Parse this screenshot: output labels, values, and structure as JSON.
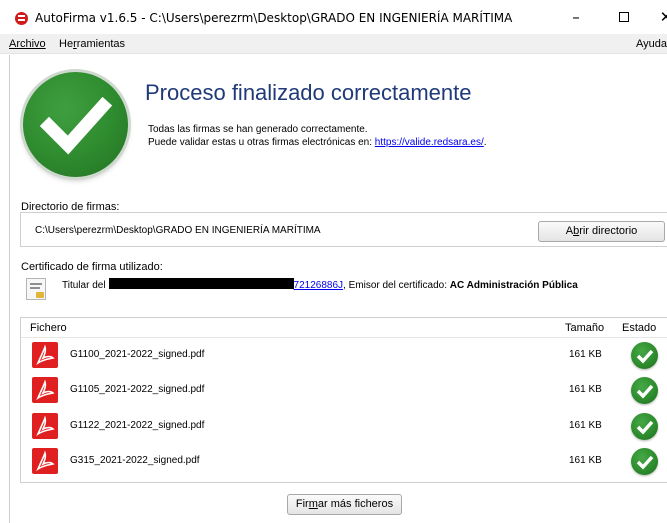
{
  "window": {
    "title": "AutoFirma v1.6.5 - C:\\Users\\perezrm\\Desktop\\GRADO EN INGENIERÍA MARÍTIMA",
    "minimize": "–",
    "close": "✕"
  },
  "menu": {
    "archivo": "Archivo",
    "herramientas_pre": "He",
    "herramientas_u": "r",
    "herramientas_post": "ramientas",
    "ayuda": "Ayuda"
  },
  "result": {
    "heading": "Proceso finalizado correctamente",
    "line1": "Todas las firmas se han generado correctamente.",
    "line2_prefix": "Puede validar estas u otras firmas electrónicas en: ",
    "validate_link": "https://valide.redsara.es/",
    "line2_suffix": "."
  },
  "directory": {
    "label": "Directorio de firmas:",
    "path": "C:\\Users\\perezrm\\Desktop\\GRADO EN INGENIERÍA MARÍTIMA",
    "open_pre": "A",
    "open_u": "b",
    "open_post": "rir directorio"
  },
  "certificate": {
    "label": "Certificado de firma utilizado:",
    "holder_prefix": "Titular del",
    "holder_id": "72126886J",
    "issuer_label": ", Emisor del certificado: ",
    "issuer": "AC Administración Pública"
  },
  "files": {
    "col_file": "Fichero",
    "col_size": "Tamaño",
    "col_state": "Estado",
    "rows": [
      {
        "name": "G1100_2021-2022_signed.pdf",
        "size": "161 KB"
      },
      {
        "name": "G1105_2021-2022_signed.pdf",
        "size": "161 KB"
      },
      {
        "name": "G1122_2021-2022_signed.pdf",
        "size": "161 KB"
      },
      {
        "name": "G315_2021-2022_signed.pdf",
        "size": "161 KB"
      }
    ]
  },
  "actions": {
    "more_pre": "Fir",
    "more_u": "m",
    "more_post": "ar más ficheros"
  },
  "colors": {
    "heading": "#1f3a78",
    "success_green": "#2e8a2e",
    "pdf_red": "#e02020",
    "link": "#0000ee"
  }
}
